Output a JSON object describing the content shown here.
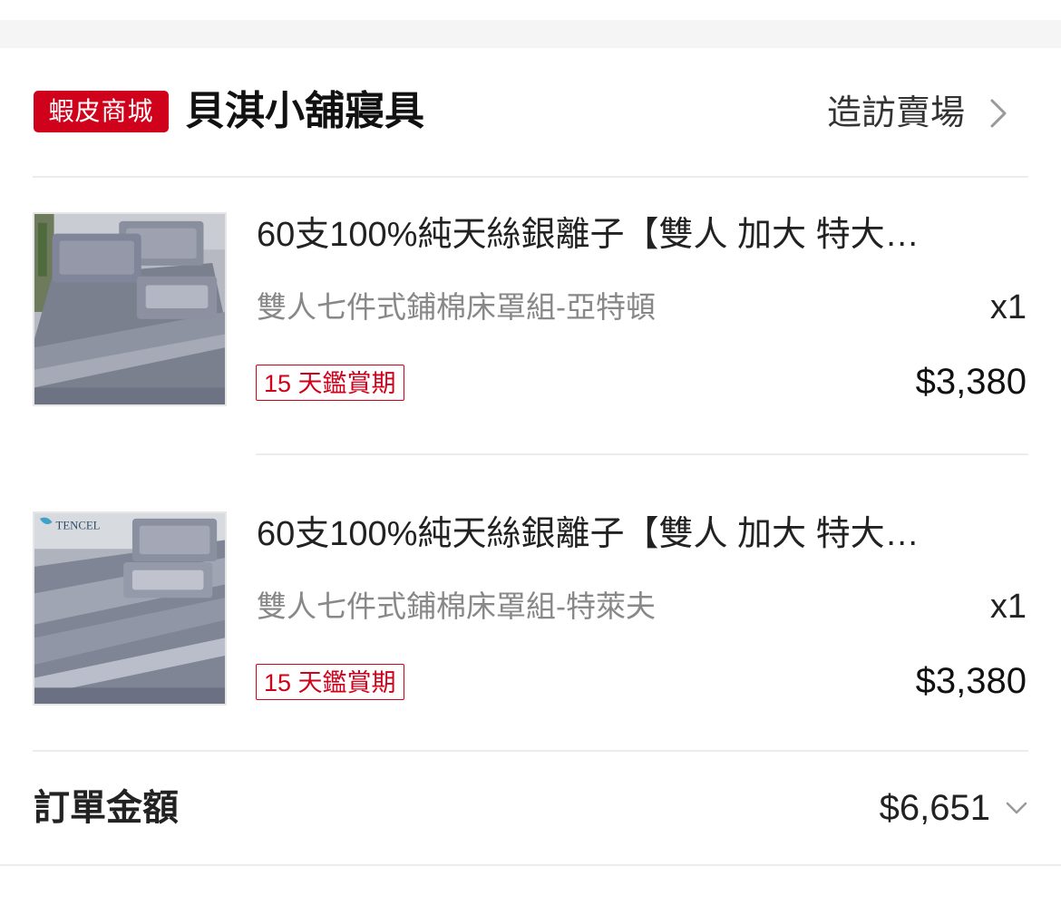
{
  "shop": {
    "badge": "蝦皮商城",
    "name": "貝淇小舖寢具",
    "visit_label": "造訪賣場"
  },
  "products": [
    {
      "title": "60支100%純天絲銀離子【雙人 加大 特大…",
      "variant": "雙人七件式鋪棉床罩組-亞特頓",
      "qty": "x1",
      "tag": "15 天鑑賞期",
      "price": "$3,380",
      "image_brand": ""
    },
    {
      "title": "60支100%純天絲銀離子【雙人 加大 特大…",
      "variant": "雙人七件式鋪棉床罩組-特萊夫",
      "qty": "x1",
      "tag": "15 天鑑賞期",
      "price": "$3,380",
      "image_brand": "TENCEL"
    }
  ],
  "order_total": {
    "label": "訂單金額",
    "value": "$6,651"
  },
  "colors": {
    "brand_red": "#d0011b",
    "divider": "#ececec",
    "section_gap": "#f5f5f5"
  },
  "icons": {
    "visit_chevron": "chevron-right-icon",
    "total_chevron": "chevron-down-icon"
  }
}
